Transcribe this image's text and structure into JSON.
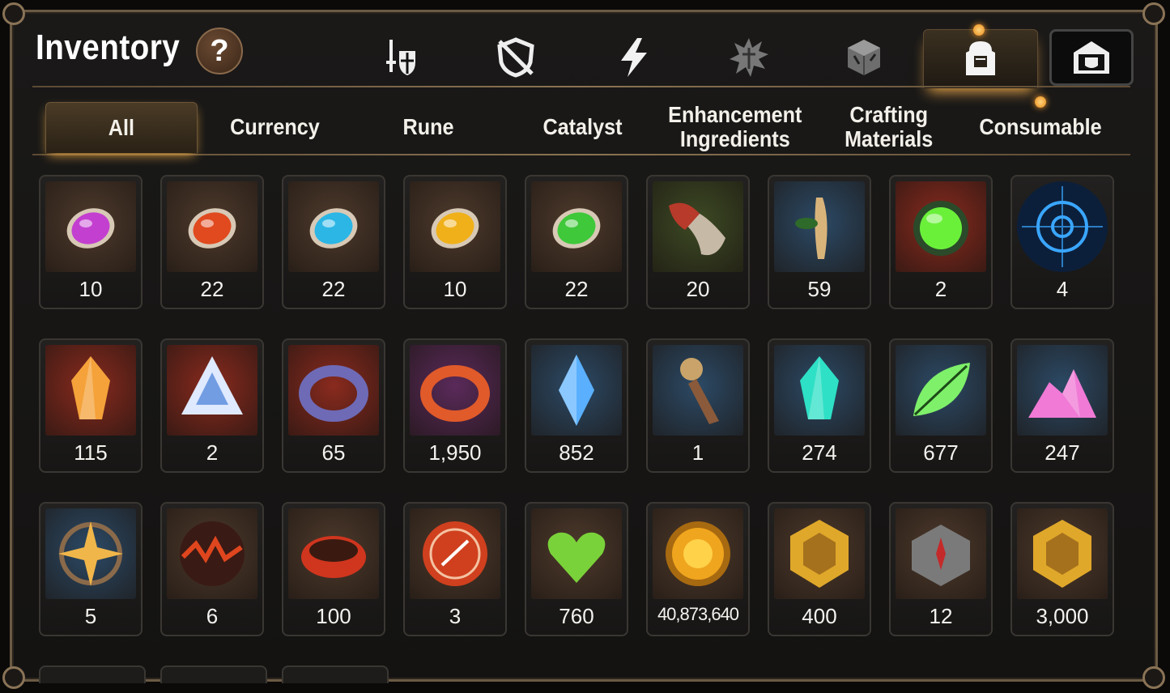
{
  "header": {
    "title": "Inventory",
    "help_label": "?"
  },
  "top_tabs": [
    {
      "name": "equipment-icon"
    },
    {
      "name": "crossed-shield-icon"
    },
    {
      "name": "lightning-icon"
    },
    {
      "name": "spiky-emblem-icon"
    },
    {
      "name": "cube-icon"
    },
    {
      "name": "bag-icon",
      "active": true
    },
    {
      "name": "shop-icon"
    }
  ],
  "sub_tabs": [
    {
      "label": "All",
      "active": true
    },
    {
      "label": "Currency"
    },
    {
      "label": "Rune"
    },
    {
      "label": "Catalyst"
    },
    {
      "label": "Enhancement\nIngredients"
    },
    {
      "label": "Crafting\nMaterials"
    },
    {
      "label": "Consumable",
      "notification": true
    }
  ],
  "items": [
    {
      "icon": "purple-rune-icon",
      "count": "10",
      "bg": "#4e3a2c",
      "color": "#c33fd0"
    },
    {
      "icon": "red-rune-icon",
      "count": "22",
      "bg": "#4e3a2c",
      "color": "#e04a1e"
    },
    {
      "icon": "blue-rune-icon",
      "count": "22",
      "bg": "#4e3a2c",
      "color": "#2bb6e6"
    },
    {
      "icon": "yellow-rune-icon",
      "count": "10",
      "bg": "#4e3a2c",
      "color": "#f0b01a"
    },
    {
      "icon": "green-rune-icon",
      "count": "22",
      "bg": "#4e3a2c",
      "color": "#3ec83a"
    },
    {
      "icon": "red-claw-icon",
      "count": "20",
      "bg": "#3d4a24",
      "color": "#b73a2a"
    },
    {
      "icon": "ginseng-root-icon",
      "count": "59",
      "bg": "#2c4a66",
      "color": "#d9b47a"
    },
    {
      "icon": "green-potion-icon",
      "count": "2",
      "bg": "#8a2a1e",
      "color": "#6bf03a"
    },
    {
      "icon": "blue-rune-circle-icon",
      "count": "4",
      "bg": "#0d2a4a",
      "color": "#3aa6ff"
    },
    {
      "icon": "orange-crystal-icon",
      "count": "115",
      "bg": "#8a2a1e",
      "color": "#f5a23a"
    },
    {
      "icon": "triangle-crystal-icon",
      "count": "2",
      "bg": "#8a2a1e",
      "color": "#dfe9ff"
    },
    {
      "icon": "bead-pendant-icon",
      "count": "65",
      "bg": "#8a2a1e",
      "color": "#6e6ab6"
    },
    {
      "icon": "flower-ring-icon",
      "count": "1,950",
      "bg": "#5a2a5a",
      "color": "#e05a2a"
    },
    {
      "icon": "blue-gem-icon",
      "count": "852",
      "bg": "#2c4a66",
      "color": "#5ab0ff"
    },
    {
      "icon": "compass-pendulum-icon",
      "count": "1",
      "bg": "#2c4a66",
      "color": "#c9a36a"
    },
    {
      "icon": "teal-crystal-icon",
      "count": "274",
      "bg": "#2c4a66",
      "color": "#2ee0c6"
    },
    {
      "icon": "green-leaf-icon",
      "count": "677",
      "bg": "#2c4a66",
      "color": "#7ef06a"
    },
    {
      "icon": "pink-crystal-pile-icon",
      "count": "247",
      "bg": "#2c4a66",
      "color": "#f07ad6"
    },
    {
      "icon": "star-amulet-icon",
      "count": "5",
      "bg": "#2c4a66",
      "color": "#f0b64a"
    },
    {
      "icon": "lava-orb-icon",
      "count": "6",
      "bg": "#4e3a2c",
      "color": "#e0461e"
    },
    {
      "icon": "red-bracelet-icon",
      "count": "100",
      "bg": "#4e3a2c",
      "color": "#d0351e"
    },
    {
      "icon": "seal-badge-icon",
      "count": "3",
      "bg": "#4e3a2c",
      "color": "#d0401e"
    },
    {
      "icon": "green-heart-icon",
      "count": "760",
      "bg": "#4e3a2c",
      "color": "#7ad23a"
    },
    {
      "icon": "gold-coin-icon",
      "count": "40,873,640",
      "bg": "#4e3a2c",
      "color": "#f0a51e"
    },
    {
      "icon": "gold-emblem-icon",
      "count": "400",
      "bg": "#4e3a2c",
      "color": "#e0a82a"
    },
    {
      "icon": "stone-compass-icon",
      "count": "12",
      "bg": "#4e3a2c",
      "color": "#7a7a7a"
    },
    {
      "icon": "fist-badge-icon",
      "count": "3,000",
      "bg": "#4e3a2c",
      "color": "#e0a82a"
    }
  ]
}
